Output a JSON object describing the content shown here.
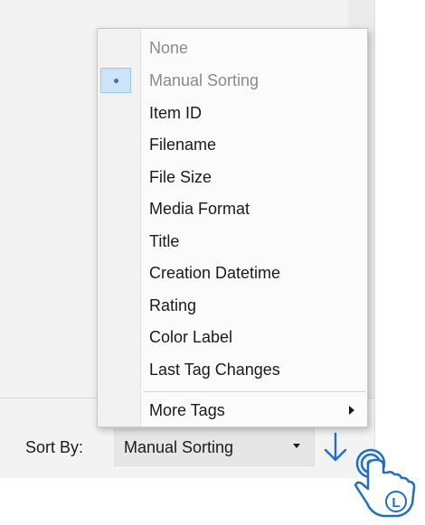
{
  "sort_bar": {
    "label": "Sort By:",
    "selected_value": "Manual Sorting",
    "order_icon": "arrow-down-icon"
  },
  "sort_menu": {
    "items": [
      {
        "label": "None",
        "disabled": true,
        "checked": false
      },
      {
        "label": "Manual Sorting",
        "disabled": true,
        "checked": true
      },
      {
        "label": "Item ID",
        "disabled": false,
        "checked": false
      },
      {
        "label": "Filename",
        "disabled": false,
        "checked": false
      },
      {
        "label": "File Size",
        "disabled": false,
        "checked": false
      },
      {
        "label": "Media Format",
        "disabled": false,
        "checked": false
      },
      {
        "label": "Title",
        "disabled": false,
        "checked": false
      },
      {
        "label": "Creation Datetime",
        "disabled": false,
        "checked": false
      },
      {
        "label": "Rating",
        "disabled": false,
        "checked": false
      },
      {
        "label": "Color Label",
        "disabled": false,
        "checked": false
      },
      {
        "label": "Last Tag Changes",
        "disabled": false,
        "checked": false
      }
    ],
    "more_item": {
      "label": "More Tags",
      "has_submenu": true
    }
  },
  "cursor": {
    "icon": "hand-pointer-icon",
    "badge": "L"
  },
  "colors": {
    "accent_blue": "#1f6fc5",
    "check_bg": "#cce4f7",
    "disabled_text": "#8a8a8a"
  }
}
